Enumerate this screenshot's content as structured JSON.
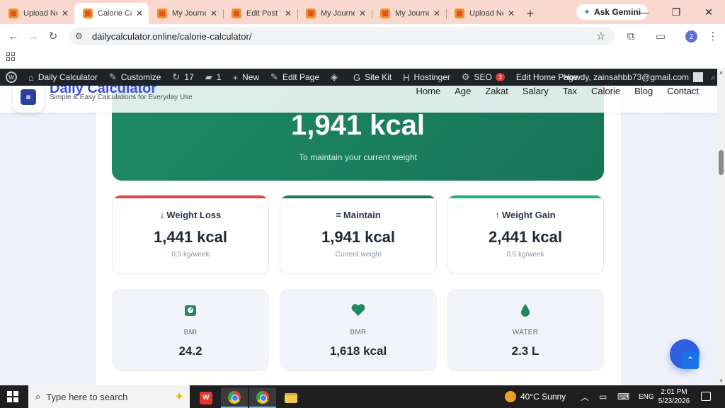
{
  "browser": {
    "tabs": [
      {
        "title": "Upload Ne",
        "active": false
      },
      {
        "title": "Calorie Cal",
        "active": true
      },
      {
        "title": "My Journey",
        "active": false
      },
      {
        "title": "Edit Post \"I",
        "active": false
      },
      {
        "title": "My Journey",
        "active": false
      },
      {
        "title": "My Journey",
        "active": false
      },
      {
        "title": "Upload Ne",
        "active": false
      }
    ],
    "gemini_label": "Ask Gemini",
    "url": "dailycalculator.online/calorie-calculator/",
    "profile_initial": "Z"
  },
  "wp_admin_bar": {
    "site_name": "Daily Calculator",
    "customize": "Customize",
    "updates_count": "17",
    "comments_count": "1",
    "new_label": "New",
    "edit_page": "Edit Page",
    "site_kit": "Site Kit",
    "hostinger": "Hostinger",
    "seo": "SEO",
    "seo_badge": "3",
    "edit_home": "Edit Home Page",
    "howdy": "Howdy, zainsahbb73@gmail.com"
  },
  "site": {
    "brand": "Daily Calculator",
    "tagline": "Simple & Easy Calculations for Everyday Use",
    "nav": [
      "Home",
      "Age",
      "Zakat",
      "Salary",
      "Tax",
      "Calorie",
      "Blog",
      "Contact"
    ]
  },
  "result": {
    "calories": "1,941 kcal",
    "caption": "To maintain your current weight"
  },
  "goals": [
    {
      "title": "Weight Loss",
      "arrow": "↓",
      "value": "1,441 kcal",
      "note": "0.5 kg/week",
      "color": "#e0474c"
    },
    {
      "title": "Maintain",
      "arrow": "=",
      "value": "1,941 kcal",
      "note": "Current weight",
      "color": "#1e7a5c"
    },
    {
      "title": "Weight Gain",
      "arrow": "↑",
      "value": "2,441 kcal",
      "note": "0.5 kg/week",
      "color": "#20b07a"
    }
  ],
  "metrics": [
    {
      "label": "BMI",
      "value": "24.2",
      "icon": "scale-icon"
    },
    {
      "label": "BMR",
      "value": "1,618 kcal",
      "icon": "heart-icon"
    },
    {
      "label": "WATER",
      "value": "2.3 L",
      "icon": "water-drop-icon"
    }
  ],
  "taskbar": {
    "search_placeholder": "Type here to search",
    "weather": "40°C  Sunny",
    "language": "ENG",
    "time": "2:01 PM",
    "date": "5/23/2026"
  }
}
